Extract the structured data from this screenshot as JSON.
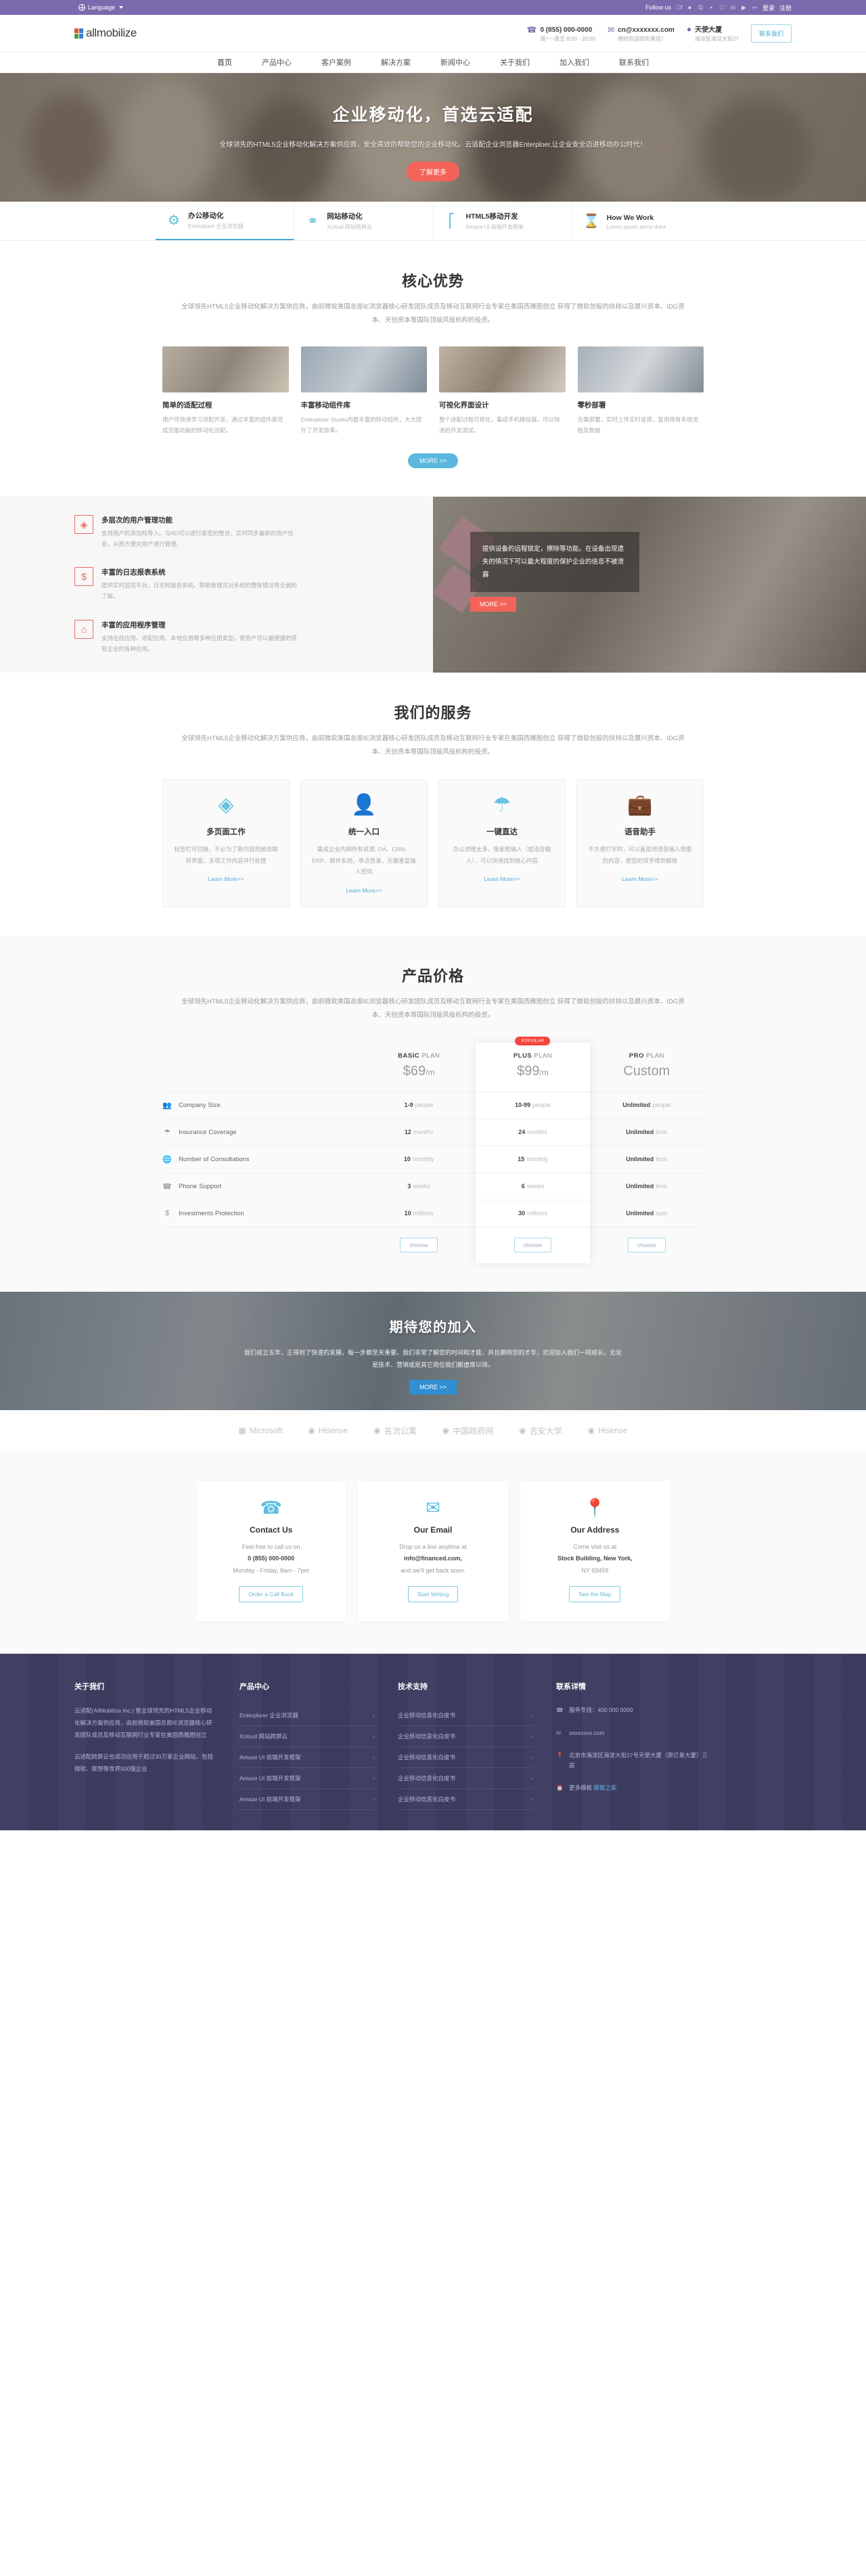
{
  "topbar": {
    "language_label": "Language",
    "globe_icon": "globe-icon",
    "follow_label": "Follow us",
    "social": [
      "f",
      "t",
      "G+",
      "b",
      "ig",
      "in",
      "yt",
      "rss"
    ],
    "login_label": "登录",
    "register_label": "注册"
  },
  "header": {
    "logo_text": "allmobilize",
    "phone_icon": "phone-icon",
    "phone": "0 (855) 000-0000",
    "phone_sub": "周一~周五  8:00 - 20:00",
    "email_icon": "envelope-icon",
    "email": "cn@xxxxxxx.com",
    "email_sub": "随时欢迎您的来信！",
    "address_icon": "map-pin-icon",
    "address": "天使大厦",
    "address_sub": "海淀区海淀大街27",
    "cta_label": "联系我们"
  },
  "nav": {
    "items": [
      {
        "label": "首页",
        "active": true
      },
      {
        "label": "产品中心",
        "active": false
      },
      {
        "label": "客户案例",
        "active": false
      },
      {
        "label": "解决方案",
        "active": false
      },
      {
        "label": "新闻中心",
        "active": false
      },
      {
        "label": "关于我们",
        "active": false
      },
      {
        "label": "加入我们",
        "active": false
      },
      {
        "label": "联系我们",
        "active": false
      }
    ]
  },
  "hero": {
    "title": "企业移动化，首选云适配",
    "paragraph": "全球领先的HTML5企业移动化解决方案供应商，安全高效的帮助您的企业移动化。云适配企业浏览器Enterploer,让企业安全迈进移动办公时代！",
    "cta_label": "了解更多"
  },
  "feature_tabs": [
    {
      "icon": "gear-icon",
      "title": "办公移动化",
      "sub": "Enterplorer 企业浏览器",
      "active": true
    },
    {
      "icon": "bulb-icon",
      "title": "网站移动化",
      "sub": "Xcloud 网站跨屏云",
      "active": false
    },
    {
      "icon": "chart-icon",
      "title": "HTML5移动开发",
      "sub": "Amaze UI 前端开发框架",
      "active": false
    },
    {
      "icon": "hourglass-icon",
      "title": "How We Work",
      "sub": "Lorem ipsum asmo dolor",
      "active": false
    }
  ],
  "core": {
    "title": "核心优势",
    "subtitle": "全球领先HTML5企业移动化解决方案供应商，由前微软美国总部IE浏览器核心研发团队成员及移动互联网行业专家在美国西雅图创立 获得了微软创投的扶持以及晨兴资本、IDG资本、天创资本等国际顶级风投机构的投资。",
    "cards": [
      {
        "title": "简单的适配过程",
        "desc": "用户可快速学习适配开发，通过丰富的组件库完成页面功能的移动化适配。"
      },
      {
        "title": "丰富移动组件库",
        "desc": "Enterplorer Studio内置丰富的移动组件，大大提升了开发效率。"
      },
      {
        "title": "可视化界面设计",
        "desc": "整个适配过程可视化，集成手机模拟器，可以快速的开发调试。"
      },
      {
        "title": "零秒部署",
        "desc": "无需部署，实时上传实时呈现，复用现有系统流程及数据"
      }
    ],
    "more_label": "MORE >>"
  },
  "split": {
    "features": [
      {
        "icon": "diamond-icon",
        "title": "多层次的用户管理功能",
        "desc": "支持用户的添加和导入。与AD可以进行紧密的整合，实时同步最新的用户信息，从而方便对用户进行管理。"
      },
      {
        "icon": "dollar-icon",
        "title": "丰富的日志报表系统",
        "desc": "提供实时监控平台，日志和报告系统。帮助管理员对系统的整体情况有全面的了解。"
      },
      {
        "icon": "bank-icon",
        "title": "丰富的应用程序管理",
        "desc": "支持在线应用、适配应用、本地应用等多种应用类型。使用户可以最便捷的获取企业的各种应用。"
      }
    ],
    "panel_text": "提供设备的远程锁定，擦除等功能。在设备出现遗失的情况下可以最大程度的保护企业的信息不被泄露",
    "more_label": "MORE >>"
  },
  "services": {
    "title": "我们的服务",
    "subtitle": "全球领先HTML5企业移动化解决方案供应商，由前微软美国总部IE浏览器核心研发团队成员及移动互联网行业专家在美国西雅图创立 获得了微软创投的扶持以及晨兴资本、IDG资本、天创资本等国际顶级风投机构的投资。",
    "cards": [
      {
        "icon": "diamond-icon",
        "title": "多页面工作",
        "desc": "标签栏可切换，不必为了新内容而被迫跳转界面，多项工作内容并行处理",
        "link": "Learn More>>"
      },
      {
        "icon": "user-icon",
        "title": "统一入口",
        "desc": "集成企业内网所有资源, OA、CRM、ERP、邮件系统，单点登录，无需重复输入密码",
        "link": "Learn More>>"
      },
      {
        "icon": "umbrella-icon",
        "title": "一键直达",
        "desc": "办公流程太多，搜索框输入（或语音输入），可以快速找到核心内容",
        "link": "Learn More>>"
      },
      {
        "icon": "briefcase-icon",
        "title": "语音助手",
        "desc": "不方便打字时，可以直接用语音输入想要的内容，使您的双手得到解放",
        "link": "Learn More>>"
      }
    ]
  },
  "pricing": {
    "title": "产品价格",
    "subtitle": "全球领先HTML5企业移动化解决方案供应商，由前微软美国总部IE浏览器核心研发团队成员及移动互联网行业专家在美国西雅图创立 获得了微软创投的扶持以及晨兴资本、IDG资本、天创资本等国际顶级风投机构的投资。",
    "popular_badge": "POPULAR",
    "rows": [
      {
        "icon": "people-icon",
        "label": "Company Size"
      },
      {
        "icon": "umbrella-icon",
        "label": "Insurance Coverage"
      },
      {
        "icon": "globe-icon",
        "label": "Number of Consultations"
      },
      {
        "icon": "phone-icon",
        "label": "Phone Support"
      },
      {
        "icon": "dollar-icon",
        "label": "Investments Protection"
      }
    ],
    "plans": [
      {
        "name_bold": "BASIC",
        "name_rest": " PLAN",
        "price_main": "$69",
        "price_unit": "/m",
        "featured": false,
        "popular": false,
        "choose_label": "choose",
        "values": [
          {
            "b": "1-9",
            "t": "people"
          },
          {
            "b": "12",
            "t": "months"
          },
          {
            "b": "10",
            "t": "monthly"
          },
          {
            "b": "3",
            "t": "weeks"
          },
          {
            "b": "10",
            "t": "millions"
          }
        ]
      },
      {
        "name_bold": "PLUS",
        "name_rest": " PLAN",
        "price_main": "$99",
        "price_unit": "/m",
        "featured": true,
        "popular": true,
        "choose_label": "choose",
        "values": [
          {
            "b": "10-99",
            "t": "people"
          },
          {
            "b": "24",
            "t": "months"
          },
          {
            "b": "15",
            "t": "monthly"
          },
          {
            "b": "6",
            "t": "weeks"
          },
          {
            "b": "30",
            "t": "millions"
          }
        ]
      },
      {
        "name_bold": "PRO",
        "name_rest": " PLAN",
        "price_main": "Custom",
        "price_unit": "",
        "featured": false,
        "popular": false,
        "choose_label": "choose",
        "values": [
          {
            "b": "Unlimited",
            "t": "people"
          },
          {
            "b": "Unlimited",
            "t": "time"
          },
          {
            "b": "Unlimited",
            "t": "time"
          },
          {
            "b": "Unlimited",
            "t": "time"
          },
          {
            "b": "Unlimited",
            "t": "sum"
          }
        ]
      }
    ]
  },
  "join": {
    "title": "期待您的加入",
    "paragraph": "我们成立五年，正得到了快速的发展，每一步都至关重要。我们非常了解您的时间和才能，并且期待您的才华，欢迎加入我们一同成长，无论是技术、营销或是其它岗位我们都虚席以待。",
    "cta_label": "MORE >>"
  },
  "clients": [
    {
      "name": "Microsoft",
      "icon": "grid-icon"
    },
    {
      "name": "Hisense",
      "icon": "text-logo"
    },
    {
      "name": "名流公寓",
      "icon": "circle-icon"
    },
    {
      "name": "中国政府网",
      "icon": "circle-icon"
    },
    {
      "name": "吉安大学",
      "icon": "circle-icon"
    },
    {
      "name": "Hisense",
      "icon": "text-logo"
    }
  ],
  "contact": [
    {
      "icon": "phone-icon",
      "title": "Contact Us",
      "line1": "Feel free to call us on",
      "line2": "0 (855) 000-0000",
      "line3": "Monday - Friday, 8am - 7pm",
      "button": "Order a Call Back"
    },
    {
      "icon": "envelope-icon",
      "title": "Our Email",
      "line1": "Drop us a line anytime at",
      "line2": "info@financed.com,",
      "line3": "and we'll get back soon.",
      "button": "Start Writing"
    },
    {
      "icon": "map-pin-icon",
      "title": "Our Address",
      "line1": "Come visit us at",
      "line2": "Stock Building, New York,",
      "line3": "NY 93459",
      "button": "See the Map"
    }
  ],
  "footer": {
    "about_title": "关于我们",
    "about_p1": "云适配(AllMobilize Inc.) 是全球领先的HTML5企业移动化解决方案供应商，由前微软美国总部IE浏览器核心研发团队成员及移动互联网行业专家在美国西雅图创立",
    "about_p2": "云适配跨屏云也成功应用于超过30万家企业网站，包括微软、联想等世界500强企业",
    "products_title": "产品中心",
    "products": [
      "Enterplorer 企业浏览器",
      "Xcloud 网站跨屏云",
      "Amaze UI 前端开发框架",
      "Amaze UI 前端开发框架",
      "Amaze UI 前端开发框架"
    ],
    "support_title": "技术支持",
    "support": [
      "企业移动信息化白皮书",
      "企业移动信息化白皮书",
      "企业移动信息化白皮书",
      "企业移动信息化白皮书",
      "企业移动信息化白皮书"
    ],
    "contact_title": "联系详情",
    "contact_items": [
      {
        "icon": "phone-icon",
        "text": "服务专线：400 000 0000",
        "link": ""
      },
      {
        "icon": "envelope-icon",
        "text": "xxxxxxxx.com",
        "link": ""
      },
      {
        "icon": "map-pin-icon",
        "text": "北京市海淀区海淀大街27号天使大厦（原亿景大厦）三层",
        "link": ""
      },
      {
        "icon": "clock-icon",
        "text": "更多模板",
        "link": "模板之家"
      }
    ],
    "chevron": "›"
  }
}
